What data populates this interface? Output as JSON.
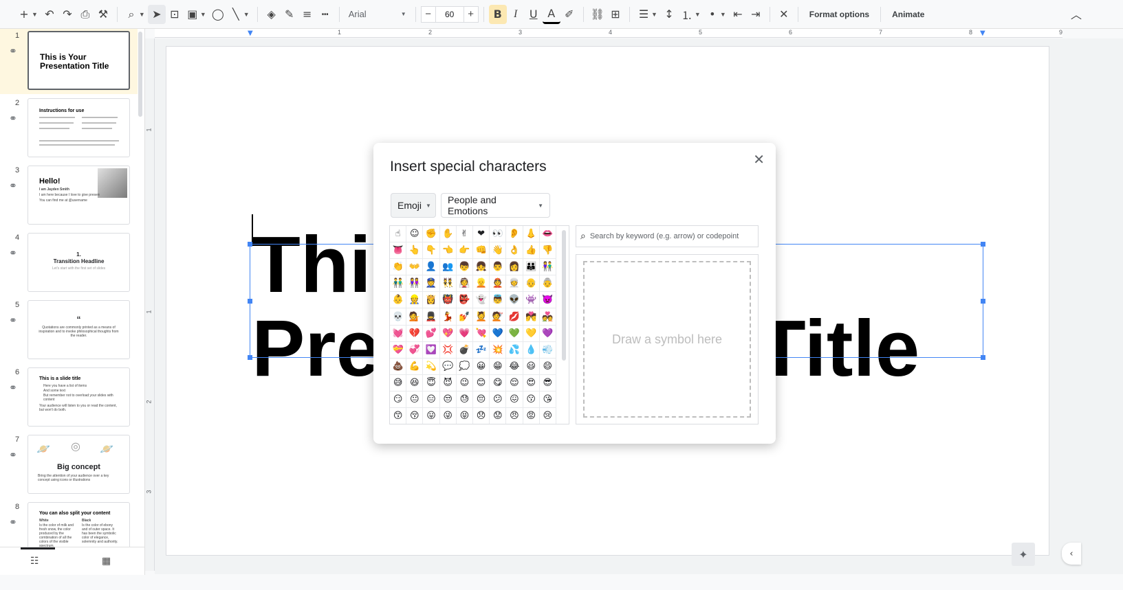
{
  "toolbar": {
    "font": "Arial",
    "font_size": "60",
    "format_options": "Format options",
    "animate": "Animate"
  },
  "slides": [
    {
      "num": "1",
      "title": "This is Your Presentation Title"
    },
    {
      "num": "2",
      "title": "Instructions for use"
    },
    {
      "num": "3",
      "title": "Hello!",
      "subtitle": "I am Jayden Smith",
      "line1": "I am here because I love to give presentations.",
      "line2": "You can find me at @username"
    },
    {
      "num": "4",
      "title": "1.\nTransition Headline",
      "subtitle": "Let's start with the first set of slides"
    },
    {
      "num": "5",
      "title": "“",
      "body": "Quotations are commonly printed as a means of inspiration and to invoke philosophical thoughts from the reader."
    },
    {
      "num": "6",
      "title": "This is a slide title",
      "b1": "Here you have a list of items",
      "b2": "And some text",
      "b3": "But remember not to overload your slides with content",
      "body": "Your audience will listen to you or read the content, but won't do both."
    },
    {
      "num": "7",
      "title": "Big concept",
      "body": "Bring the attention of your audience over a key concept using icons or illustrations"
    },
    {
      "num": "8",
      "title": "You can also split your content",
      "col1_h": "White",
      "col1": "Is the color of milk and fresh snow, the color produced by the combination of all the colors of the visible spectrum.",
      "col2_h": "Black",
      "col2": "Is the color of ebony and of outer space. It has been the symbolic color of elegance, solemnity and authority."
    }
  ],
  "ruler": [
    "1",
    "2",
    "3",
    "4",
    "5",
    "6",
    "7",
    "8",
    "9"
  ],
  "ruler_v": [
    "1",
    "1",
    "2",
    "3"
  ],
  "slide_title_line1": "This is Your",
  "slide_title_line2": "Presentation Title",
  "dialog": {
    "title": "Insert special characters",
    "category": "Emoji",
    "subcategory": "People and Emotions",
    "search_placeholder": "Search by keyword (e.g. arrow) or codepoint",
    "draw_hint": "Draw a symbol here",
    "emojis": [
      "☝",
      "☺",
      "✊",
      "✋",
      "✌",
      "❤",
      "👀",
      "👂",
      "👃",
      "👄",
      "👅",
      "👆",
      "👇",
      "👈",
      "👉",
      "👊",
      "👋",
      "👌",
      "👍",
      "👎",
      "👏",
      "👐",
      "👤",
      "👥",
      "👦",
      "👧",
      "👨",
      "👩",
      "👪",
      "👫",
      "👬",
      "👭",
      "👮",
      "👯",
      "👰",
      "👱",
      "👲",
      "👳",
      "👴",
      "👵",
      "👶",
      "👷",
      "👸",
      "👹",
      "👺",
      "👻",
      "👼",
      "👽",
      "👾",
      "👿",
      "💀",
      "💁",
      "💂",
      "💃",
      "💅",
      "💆",
      "💇",
      "💋",
      "💏",
      "💑",
      "💓",
      "💔",
      "💕",
      "💖",
      "💗",
      "💘",
      "💙",
      "💚",
      "💛",
      "💜",
      "💝",
      "💞",
      "💟",
      "💢",
      "💣",
      "💤",
      "💥",
      "💦",
      "💧",
      "💨",
      "💩",
      "💪",
      "💫",
      "💬",
      "💭",
      "😀",
      "😁",
      "😂",
      "😃",
      "😄",
      "😅",
      "😆",
      "😇",
      "😈",
      "😉",
      "😊",
      "😋",
      "😌",
      "😍",
      "😎",
      "😏",
      "😐",
      "😑",
      "😒",
      "😓",
      "😔",
      "😕",
      "😖",
      "😗",
      "😘",
      "😙",
      "😚",
      "😛",
      "😜",
      "😝",
      "😞",
      "😟",
      "😠",
      "😡",
      "😢"
    ]
  },
  "colors": {
    "selection": "#4285f4",
    "selected_slide_bg": "#fef7e0"
  }
}
